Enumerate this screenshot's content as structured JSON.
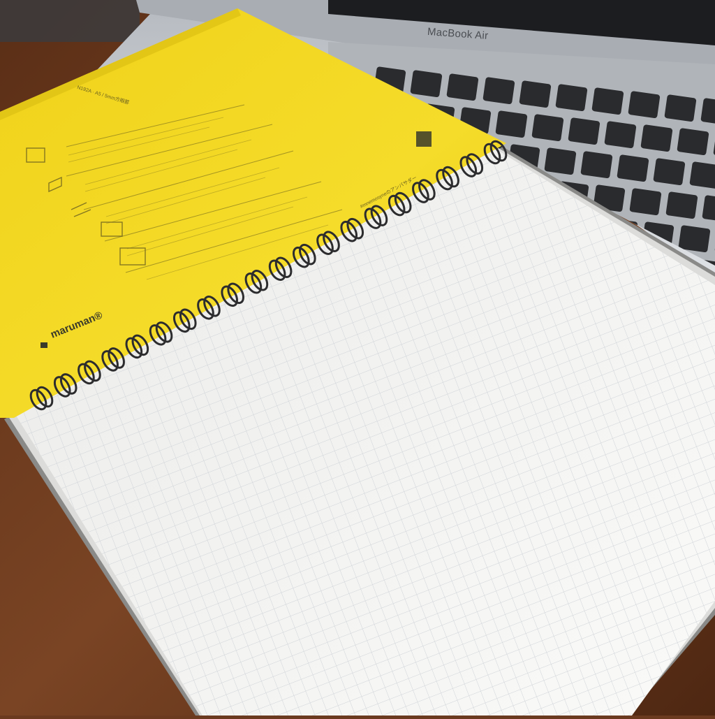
{
  "laptop": {
    "brand": "MacBook Air"
  },
  "notebook": {
    "brand": "maruman®",
    "cover_title": "N192A · A5 / 5mm方眼罫",
    "cover_side_text": "#mnemosyneのアンバサダー",
    "page_label": "",
    "cover_color": "#f2d81e",
    "page_color": "#f4f4f2",
    "grid_color": "#cfd3d8",
    "spiral_color": "#2c2c2e"
  },
  "scene": {
    "desk_color": "#6b3a1f",
    "laptop_body_color": "#c9cdd2",
    "key_color": "#2a2b2e"
  }
}
